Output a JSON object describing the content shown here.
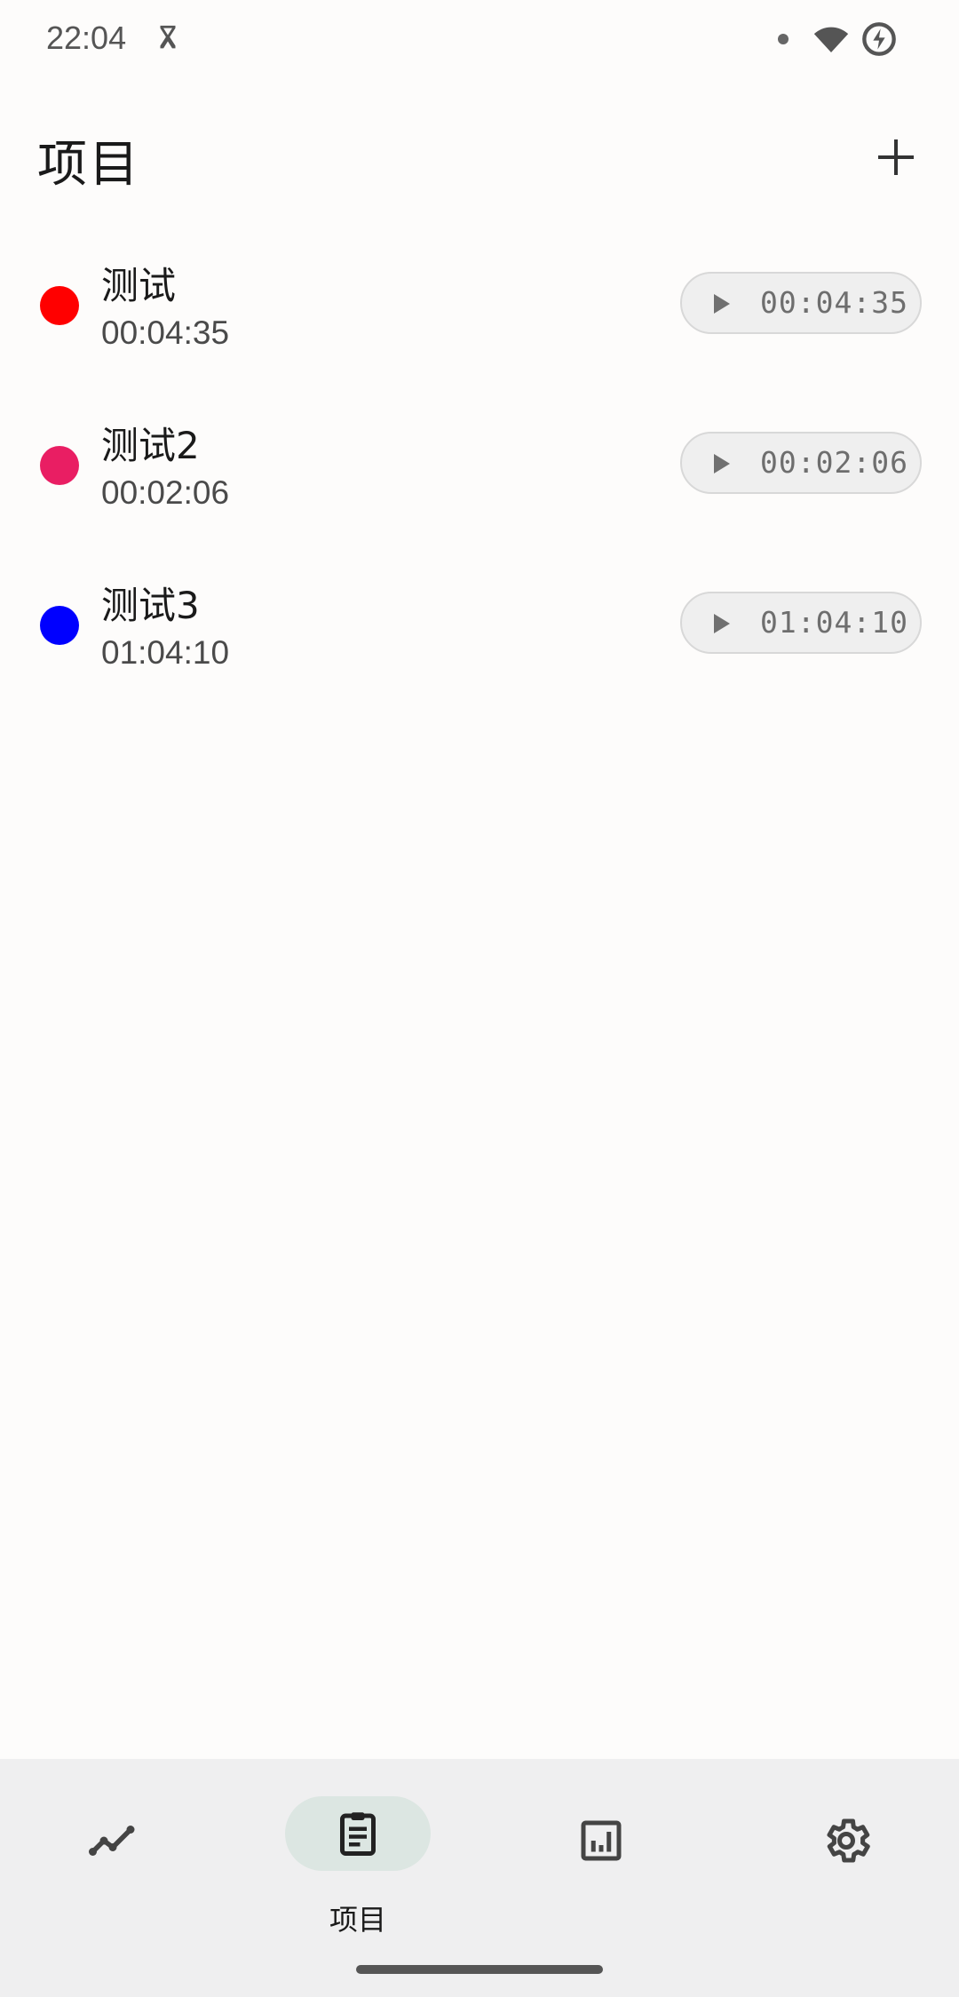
{
  "status_bar": {
    "time": "22:04",
    "hourglass_icon": "hourglass-icon",
    "wifi_icon": "wifi-icon",
    "battery_icon": "battery-saver-icon"
  },
  "header": {
    "title": "项目",
    "add_icon": "plus-icon"
  },
  "projects": [
    {
      "name": "测试",
      "time": "00:04:35",
      "button_time": "00:04:35",
      "color": "#ff0000"
    },
    {
      "name": "测试2",
      "time": "00:02:06",
      "button_time": "00:02:06",
      "color": "#e91e63"
    },
    {
      "name": "测试3",
      "time": "01:04:10",
      "button_time": "01:04:10",
      "color": "#0000ff"
    }
  ],
  "bottom_nav": {
    "items": [
      {
        "icon": "trend-line-icon",
        "label": ""
      },
      {
        "icon": "clipboard-icon",
        "label": "项目",
        "selected": true
      },
      {
        "icon": "bar-chart-icon",
        "label": ""
      },
      {
        "icon": "gear-icon",
        "label": ""
      }
    ]
  },
  "colors": {
    "background": "#fdfcfb",
    "nav_background": "#efeff0",
    "nav_selected_pill": "#dce6e2"
  }
}
